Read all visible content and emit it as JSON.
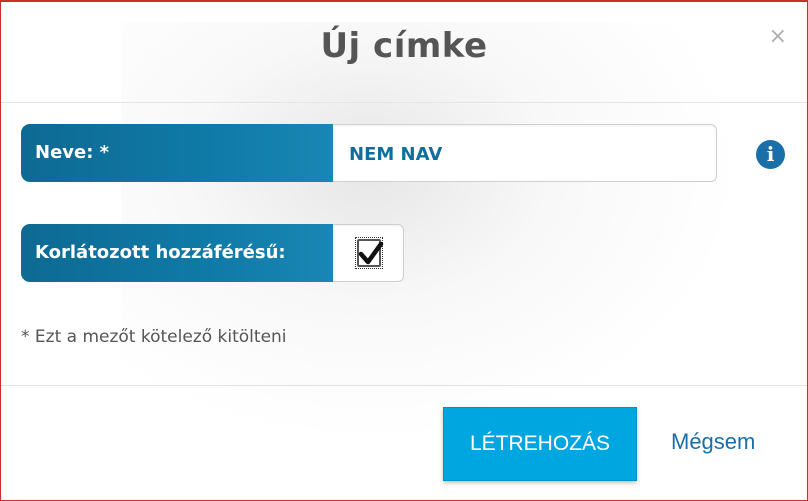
{
  "dialog": {
    "title": "Új címke",
    "close_glyph": "×"
  },
  "form": {
    "name": {
      "label": "Neve: *",
      "value": "NEM NAV"
    },
    "restricted": {
      "label": "Korlátozott hozzáférésű:",
      "checked": true
    },
    "info_glyph": "i",
    "required_note": "* Ezt a mezőt kötelező kitölteni"
  },
  "footer": {
    "create_label": "LÉTREHOZÁS",
    "cancel_label": "Mégsem"
  },
  "colors": {
    "label_bg": "#0f7aa7",
    "primary_button": "#00a6e0",
    "link": "#1a6fa8",
    "value_text": "#0f6f9c"
  }
}
